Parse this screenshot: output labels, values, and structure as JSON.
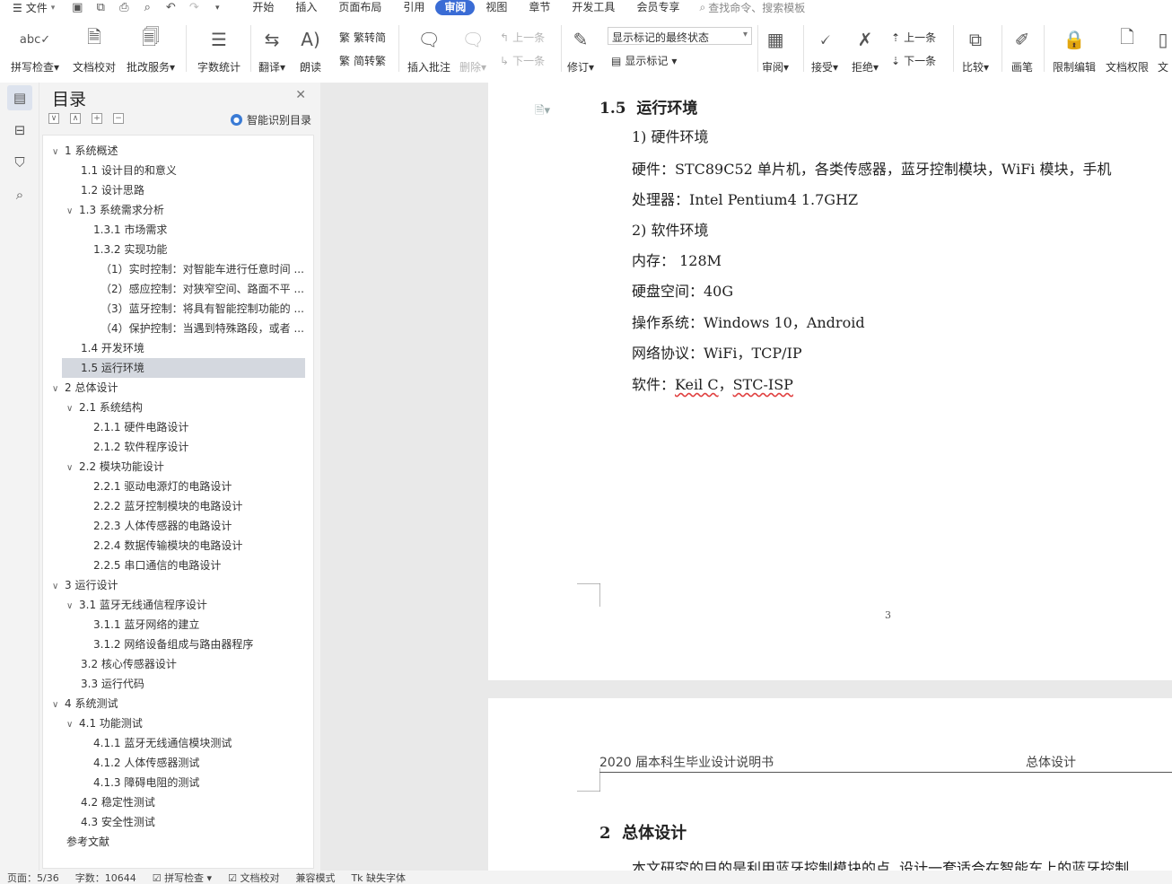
{
  "menubar": {
    "file": "文件",
    "tabs": [
      "开始",
      "插入",
      "页面布局",
      "引用",
      "审阅",
      "视图",
      "章节",
      "开发工具",
      "会员专享"
    ],
    "active_tab": "审阅",
    "search_placeholder": "查找命令、搜索模板"
  },
  "ribbon": {
    "spell": "拼写检查",
    "doc_check": "文档校对",
    "review_service": "批改服务",
    "word_count": "字数统计",
    "translate": "翻译",
    "read_aloud": "朗读",
    "trad_to_simp": "繁转简",
    "simp_to_trad": "简转繁",
    "insert_comment": "插入批注",
    "delete": "删除",
    "prev": "上一条",
    "next": "下一条",
    "track": "修订",
    "markup_state": "显示标记的最终状态",
    "show_markup": "显示标记",
    "review": "审阅",
    "accept": "接受",
    "reject": "拒绝",
    "prev2": "上一条",
    "next2": "下一条",
    "compare": "比较",
    "pen": "画笔",
    "restrict": "限制编辑",
    "permission": "文档权限",
    "more": "文"
  },
  "toc": {
    "title": "目录",
    "smart": "智能识别目录",
    "items": [
      {
        "text": "1  系统概述",
        "level": 0,
        "chev": "∨"
      },
      {
        "text": "1.1  设计目的和意义",
        "level": 1
      },
      {
        "text": "1.2  设计思路",
        "level": 1
      },
      {
        "text": "1.3  系统需求分析",
        "level": 1,
        "chev": "∨"
      },
      {
        "text": "1.3.1 市场需求",
        "level": 2
      },
      {
        "text": "1.3.2 实现功能",
        "level": 2
      },
      {
        "text": "（1）实时控制：对智能车进行任意时间 ...",
        "level": 3
      },
      {
        "text": "（2）感应控制：对狭窄空间、路面不平 ...",
        "level": 3
      },
      {
        "text": "（3）蓝牙控制：将具有智能控制功能的 ...",
        "level": 3
      },
      {
        "text": "（4）保护控制：当遇到特殊路段，或者 ...",
        "level": 3
      },
      {
        "text": "1.4  开发环境",
        "level": 1
      },
      {
        "text": "1.5  运行环境",
        "level": 1,
        "selected": true
      },
      {
        "text": "2  总体设计",
        "level": 0,
        "chev": "∨"
      },
      {
        "text": "2.1  系统结构",
        "level": 1,
        "chev": "∨"
      },
      {
        "text": "2.1.1  硬件电路设计",
        "level": 2
      },
      {
        "text": "2.1.2  软件程序设计",
        "level": 2
      },
      {
        "text": "2.2  模块功能设计",
        "level": 1,
        "chev": "∨"
      },
      {
        "text": "2.2.1  驱动电源灯的电路设计",
        "level": 2
      },
      {
        "text": "2.2.2  蓝牙控制模块的电路设计",
        "level": 2
      },
      {
        "text": "2.2.3  人体传感器的电路设计",
        "level": 2
      },
      {
        "text": "2.2.4  数据传输模块的电路设计",
        "level": 2
      },
      {
        "text": "2.2.5  串口通信的电路设计",
        "level": 2
      },
      {
        "text": "3  运行设计",
        "level": 0,
        "chev": "∨"
      },
      {
        "text": "3.1    蓝牙无线通信程序设计",
        "level": 1,
        "chev": "∨"
      },
      {
        "text": "3.1.1  蓝牙网络的建立",
        "level": 2
      },
      {
        "text": "3.1.2  网络设备组成与路由器程序",
        "level": 2
      },
      {
        "text": "3.2  核心传感器设计",
        "level": 1
      },
      {
        "text": "3.3  运行代码",
        "level": 1
      },
      {
        "text": "4  系统测试",
        "level": 0,
        "chev": "∨"
      },
      {
        "text": "4.1  功能测试",
        "level": 1,
        "chev": "∨"
      },
      {
        "text": "4.1.1  蓝牙无线通信模块测试",
        "level": 2
      },
      {
        "text": "4.1.2  人体传感器测试",
        "level": 2
      },
      {
        "text": "4.1.3  障碍电阻的测试",
        "level": 2
      },
      {
        "text": "4.2  稳定性测试",
        "level": 1
      },
      {
        "text": "4.3  安全性测试",
        "level": 1
      },
      {
        "text": "参考文献",
        "level": 0
      }
    ]
  },
  "doc": {
    "section_num": "1.5",
    "section_title": "运行环境",
    "lines": [
      "1)  硬件环境",
      "硬件：STC89C52 单片机，各类传感器，蓝牙控制模块，WiFi 模块，手机",
      "处理器：Intel Pentium4 1.7GHZ",
      "2)  软件环境",
      "内存：     128M",
      "硬盘空间：40G",
      "操作系统：Windows 10，Android",
      "网络协议：WiFi，TCP/IP"
    ],
    "software_label": "软件：",
    "software_a": "Keil C",
    "software_sep": "，",
    "software_b": "STC-ISP",
    "page_number": "3",
    "header_left": "2020 届本科生毕业设计说明书",
    "header_right": "总体设计",
    "h2_num": "2",
    "h2_title": "总体设计",
    "body_start": "本文研究的目的是利用蓝牙控制模块的点, 设计一套适合在智能车上的蓝牙控制"
  },
  "status": {
    "page": "页面：5/36",
    "words": "字数：10644",
    "spell": "拼写检查",
    "doc_check": "文档校对",
    "compat": "兼容模式",
    "missing_font": "缺失字体"
  }
}
